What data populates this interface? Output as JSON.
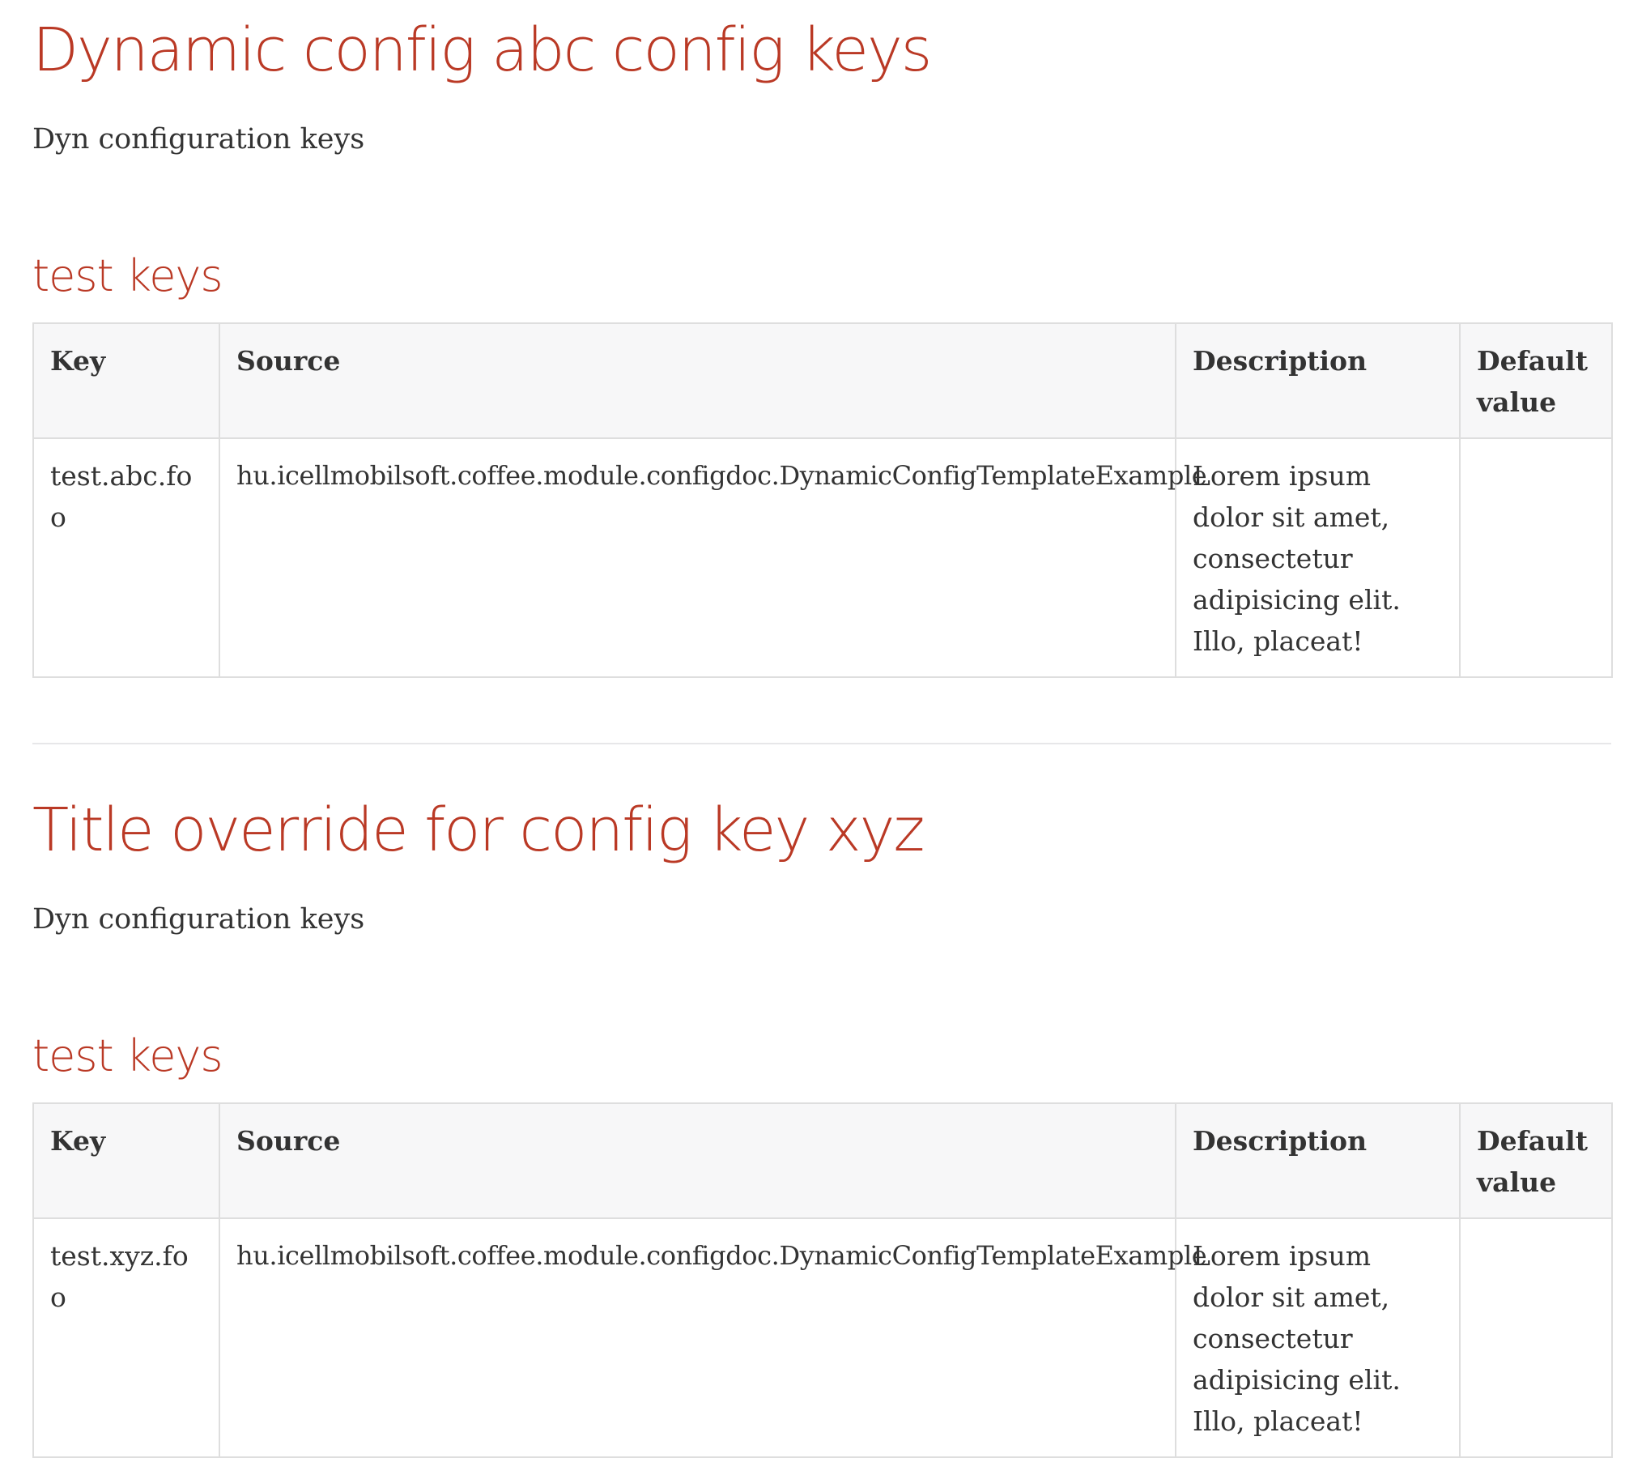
{
  "sections": [
    {
      "title": "Dynamic config abc config keys",
      "intro": "Dyn configuration keys",
      "subtitle": "test keys",
      "table": {
        "headers": [
          "Key",
          "Source",
          "Description",
          "Default value"
        ],
        "rows": [
          {
            "key": "test.abc.foo",
            "source": "hu.icellmobilsoft.coffee.module.configdoc.DynamicConfigTemplateExample",
            "description": "Lorem ipsum dolor sit amet, consectetur adipisicing elit. Illo, placeat!",
            "default_value": ""
          }
        ]
      }
    },
    {
      "title": "Title override for config key xyz",
      "intro": "Dyn configuration keys",
      "subtitle": "test keys",
      "table": {
        "headers": [
          "Key",
          "Source",
          "Description",
          "Default value"
        ],
        "rows": [
          {
            "key": "test.xyz.foo",
            "source": "hu.icellmobilsoft.coffee.module.configdoc.DynamicConfigTemplateExample",
            "description": "Lorem ipsum dolor sit amet, consectetur adipisicing elit. Illo, placeat!",
            "default_value": ""
          }
        ]
      }
    }
  ],
  "colors": {
    "heading": "#ba3925",
    "text": "#333333",
    "table_border": "#dedede",
    "table_header_bg": "#f7f7f8"
  }
}
